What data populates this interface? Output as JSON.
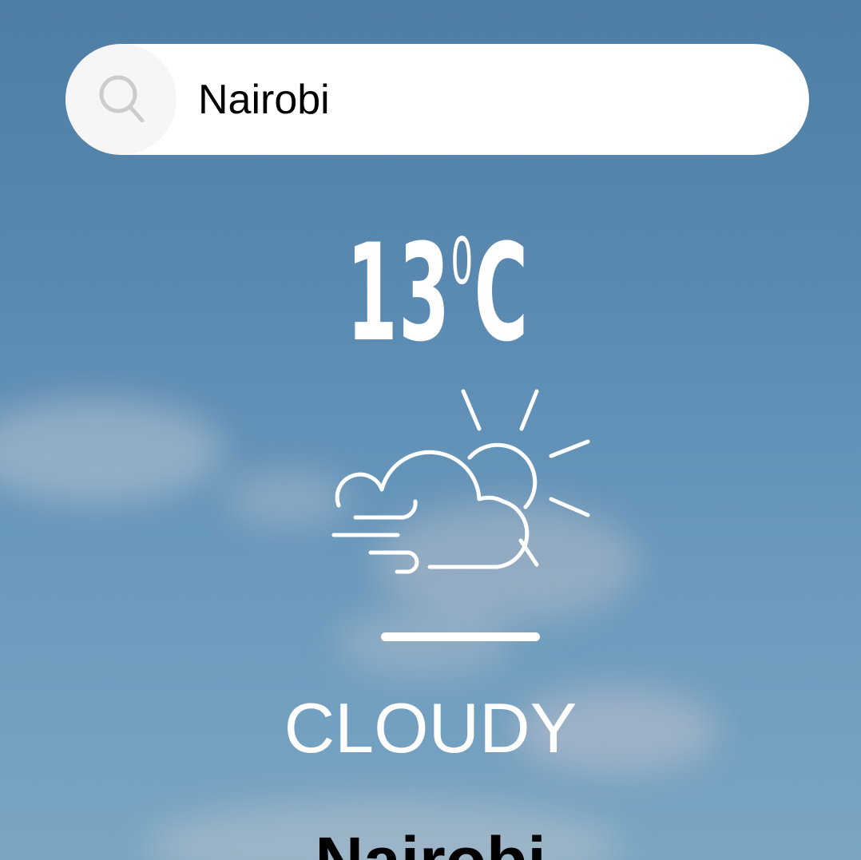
{
  "search": {
    "value": "Nairobi",
    "icon": "search-icon"
  },
  "weather": {
    "temperature": "13",
    "degree_symbol": "0",
    "unit": "C",
    "icon": "cloud-sun-wind-icon",
    "condition": "CLOUDY",
    "city": "Nairobi"
  },
  "colors": {
    "text": "#ffffff",
    "search_bg": "#ffffff",
    "search_button_bg": "#f6f6f6",
    "icon_gray": "#cccccc"
  }
}
